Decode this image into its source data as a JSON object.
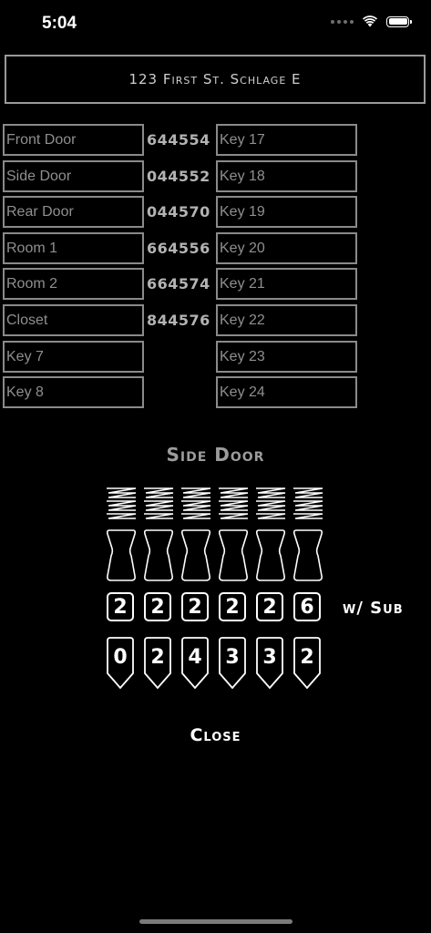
{
  "status": {
    "time": "5:04"
  },
  "title": "123 First St. Schlage E",
  "left_keys": [
    {
      "label": "Front Door",
      "code": "644554"
    },
    {
      "label": "Side Door",
      "code": "044552"
    },
    {
      "label": "Rear Door",
      "code": "044570"
    },
    {
      "label": "Room 1",
      "code": "664556"
    },
    {
      "label": "Room 2",
      "code": "664574"
    },
    {
      "label": "Closet",
      "code": "844576"
    },
    {
      "label": "Key 7",
      "code": ""
    },
    {
      "label": "Key 8",
      "code": ""
    }
  ],
  "right_keys": [
    "Key 17",
    "Key 18",
    "Key 19",
    "Key 20",
    "Key 21",
    "Key 22",
    "Key 23",
    "Key 24"
  ],
  "selected": {
    "name": "Side Door",
    "top_pins": [
      "2",
      "2",
      "2",
      "2",
      "2",
      "6"
    ],
    "bottom_pins": [
      "0",
      "2",
      "4",
      "3",
      "3",
      "2"
    ],
    "sub_label": "w/ Sub"
  },
  "close_label": "Close"
}
